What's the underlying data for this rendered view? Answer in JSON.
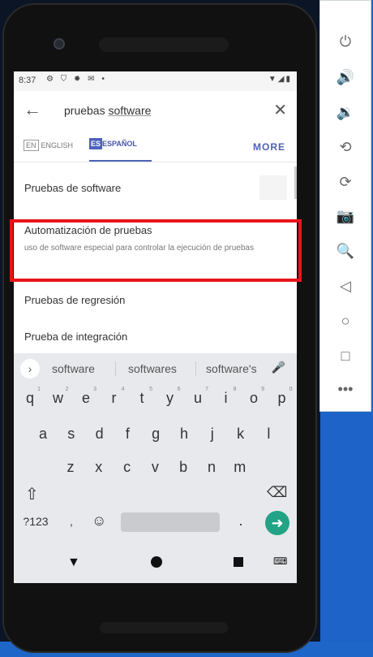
{
  "status_bar": {
    "time": "8:37",
    "left_icons": [
      "settings-icon",
      "shield-icon",
      "gear-icon",
      "mail-icon",
      "dot"
    ],
    "right_icons": [
      "wifi-icon",
      "signal-icon",
      "battery-icon"
    ]
  },
  "search": {
    "query_prefix": "pruebas ",
    "query_underlined": "software"
  },
  "language": {
    "en_badge": "EN",
    "en_label": "ENGLISH",
    "es_badge": "ES",
    "es_label": "ESPAÑOL",
    "more": "MORE"
  },
  "results": [
    {
      "title": "Pruebas de software",
      "subtitle": ""
    },
    {
      "title": "Automatización de pruebas",
      "subtitle": "uso de software especial para controlar la ejecución de pruebas"
    },
    {
      "title": "Pruebas de regresión",
      "subtitle": ""
    },
    {
      "title": "Prueba de integración",
      "subtitle": ""
    }
  ],
  "keyboard": {
    "suggestions": [
      "software",
      "softwares",
      "software's"
    ],
    "row1": [
      "q",
      "w",
      "e",
      "r",
      "t",
      "y",
      "u",
      "i",
      "o",
      "p"
    ],
    "row1_hints": [
      "1",
      "2",
      "3",
      "4",
      "5",
      "6",
      "7",
      "8",
      "9",
      "0"
    ],
    "row2": [
      "a",
      "s",
      "d",
      "f",
      "g",
      "h",
      "j",
      "k",
      "l"
    ],
    "row3": [
      "z",
      "x",
      "c",
      "v",
      "b",
      "n",
      "m"
    ],
    "symbols_key": "?123",
    "comma_key": ",",
    "period_key": "."
  },
  "emulator_panel": {
    "icons": [
      "power-icon",
      "volume-up-icon",
      "volume-down-icon",
      "rotate-left-icon",
      "rotate-right-icon",
      "camera-icon",
      "zoom-icon",
      "back-icon",
      "home-icon",
      "overview-icon",
      "more-icon"
    ]
  },
  "colors": {
    "accent": "#4d62b9",
    "highlight": "#e8151b",
    "enter": "#23a386"
  }
}
